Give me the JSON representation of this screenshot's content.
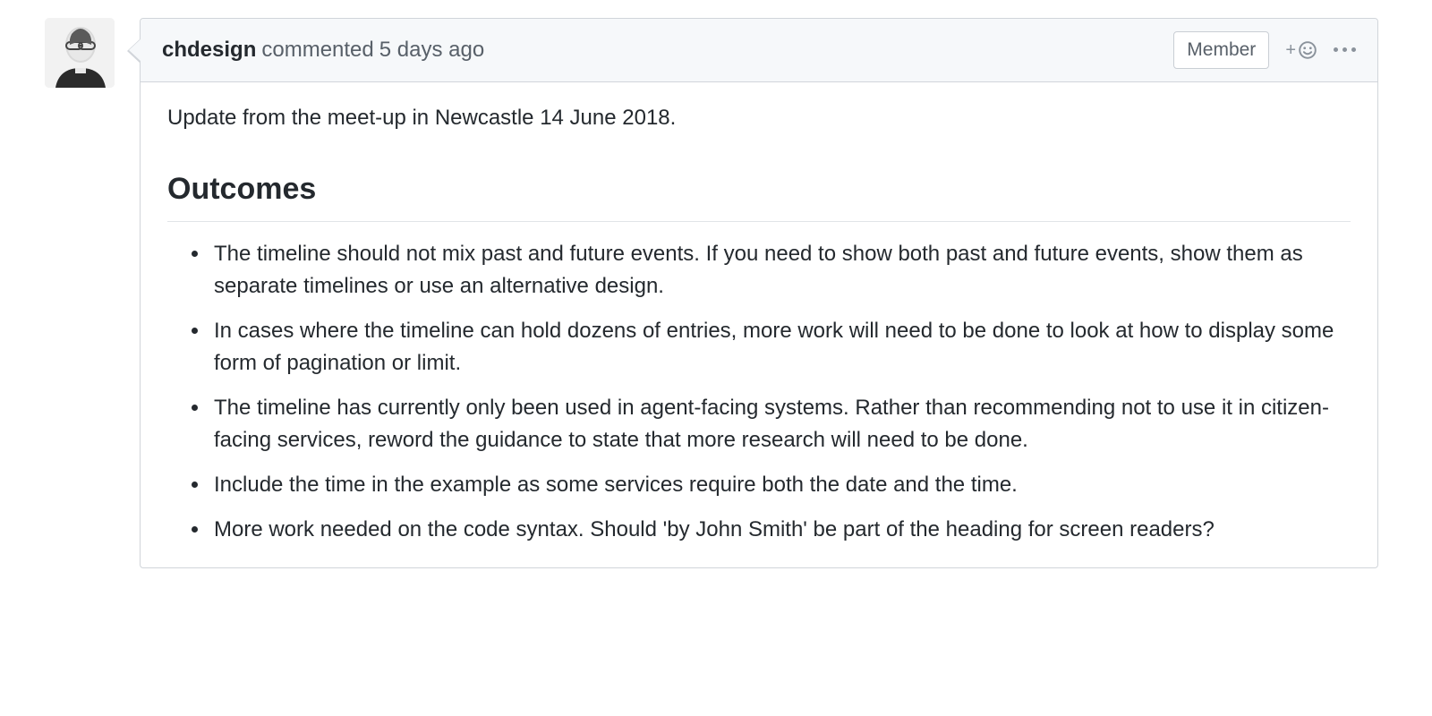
{
  "comment": {
    "author": "chdesign",
    "verb": "commented",
    "timestamp": "5 days ago",
    "role_badge": "Member",
    "body_intro": "Update from the meet-up in Newcastle 14 June 2018.",
    "outcomes_heading": "Outcomes",
    "outcomes": [
      "The timeline should not mix past and future events. If you need to show both past and future events, show them as separate timelines or use an alternative design.",
      "In cases where the timeline can hold dozens of entries, more work will need to be done to look at how to display some form of pagination or limit.",
      "The timeline has currently only been used in agent-facing systems. Rather than recommending not to use it in citizen- facing services, reword the guidance to state that more research will need to be done.",
      "Include the time in the example as some services require both the date and the time.",
      "More work needed on the code syntax. Should 'by John Smith' be part of the heading for screen readers?"
    ]
  }
}
